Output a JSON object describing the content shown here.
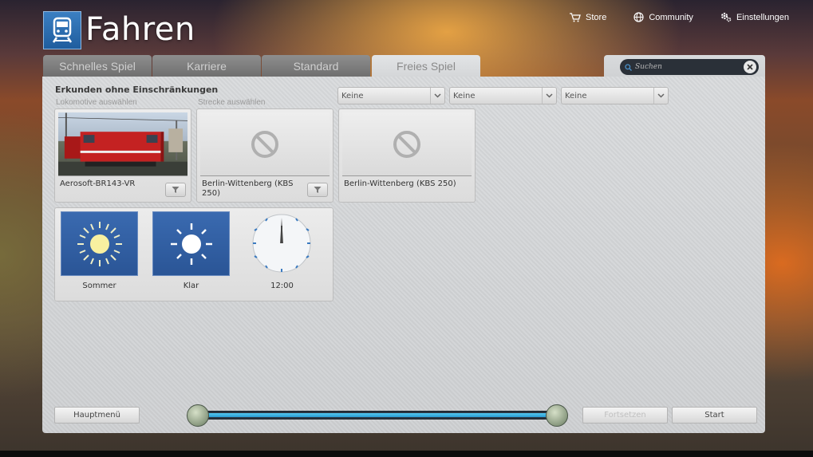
{
  "header": {
    "app_title": "Fahren",
    "nav": [
      {
        "label": "Store",
        "icon": "cart-icon"
      },
      {
        "label": "Community",
        "icon": "globe-icon"
      },
      {
        "label": "Einstellungen",
        "icon": "gear-icon"
      }
    ]
  },
  "tabs": [
    {
      "label": "Schnelles Spiel",
      "active": false
    },
    {
      "label": "Karriere",
      "active": false
    },
    {
      "label": "Standard",
      "active": false
    },
    {
      "label": "Freies Spiel",
      "active": true
    }
  ],
  "search": {
    "placeholder": "Suchen"
  },
  "panel": {
    "section_title": "Erkunden ohne Einschränkungen",
    "loco_label": "Lokomotive auswählen",
    "route_label": "Strecke auswählen",
    "dropdowns": [
      "Keine",
      "Keine",
      "Keine"
    ],
    "loco_card": {
      "name": "Aerosoft-BR143-VR"
    },
    "route_card": {
      "name": "Berlin-Wittenberg (KBS 250)"
    },
    "scenario_card": {
      "name": "Berlin-Wittenberg (KBS 250)"
    },
    "season": {
      "label": "Sommer"
    },
    "weather": {
      "label": "Klar"
    },
    "time": {
      "label": "12:00"
    }
  },
  "footer": {
    "main_menu": "Hauptmenü",
    "continue": "Fortsetzen",
    "start": "Start",
    "progress": 1.0
  },
  "colors": {
    "accent": "#2a9ad0",
    "tile_blue": "#2a5596"
  }
}
